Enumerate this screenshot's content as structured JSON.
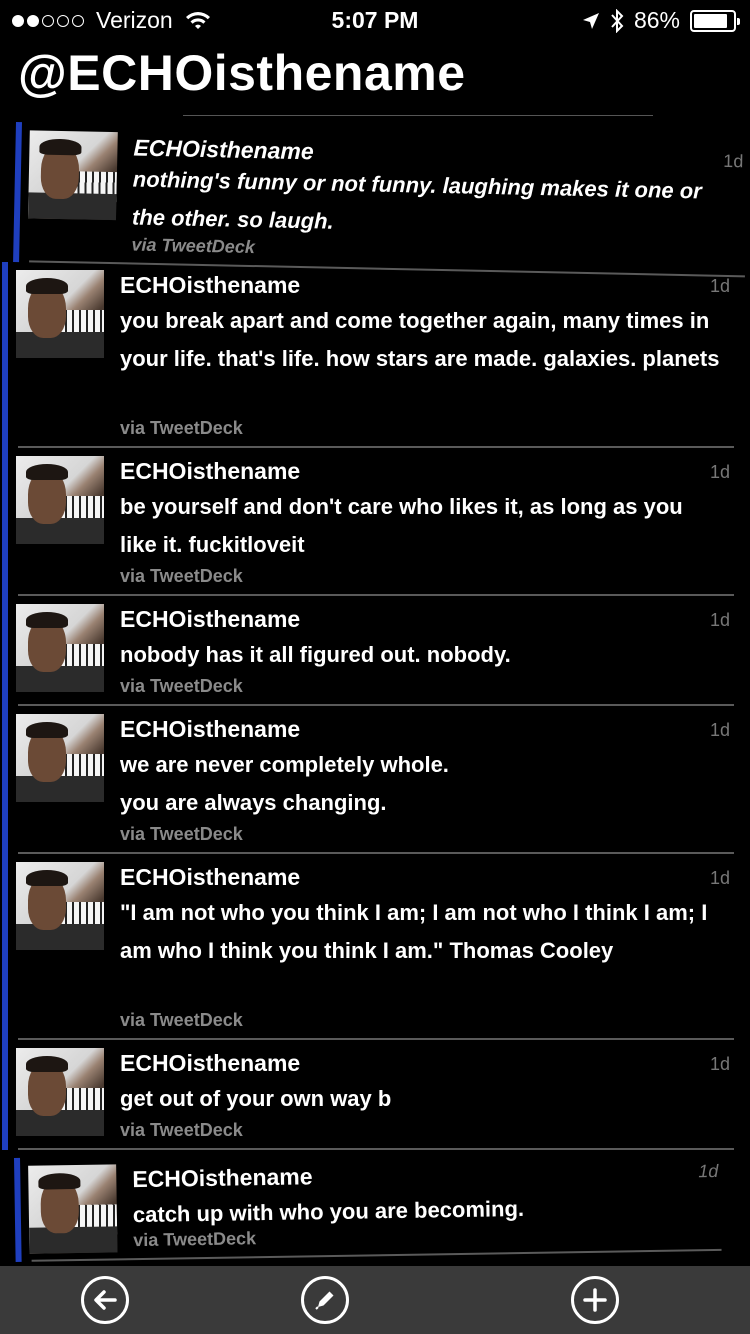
{
  "status_bar": {
    "carrier": "Verizon",
    "time": "5:07 PM",
    "battery": "86%",
    "battery_level": 0.86,
    "signal_dots_filled": 2,
    "signal_dots_total": 5
  },
  "page": {
    "title": "@ECHOisthename"
  },
  "tweets": [
    {
      "name": "ECHOisthename",
      "age": "1d",
      "text": "nothing's funny or not funny. laughing makes it one or the other. so laugh.",
      "via": "via TweetDeck"
    },
    {
      "name": "ECHOisthename",
      "age": "1d",
      "text": "you break apart and come together again, many times in your life. that's life. how stars are made. galaxies. planets",
      "via": "via TweetDeck"
    },
    {
      "name": "ECHOisthename",
      "age": "1d",
      "text": "be yourself and don't care who likes it, as long as you like it. fuckitloveit",
      "via": "via TweetDeck"
    },
    {
      "name": "ECHOisthename",
      "age": "1d",
      "text": "nobody has it all figured out. nobody.",
      "via": "via TweetDeck"
    },
    {
      "name": "ECHOisthename",
      "age": "1d",
      "text": "we are never completely whole.\nyou are always changing.",
      "via": "via TweetDeck"
    },
    {
      "name": "ECHOisthename",
      "age": "1d",
      "text": "\"I am not who you think I am; I am not who I think I am; I am who I think you think I am.\" Thomas Cooley",
      "via": "via TweetDeck"
    },
    {
      "name": "ECHOisthename",
      "age": "1d",
      "text": "get out of your own way b",
      "via": "via TweetDeck"
    },
    {
      "name": "ECHOisthename",
      "age": "1d",
      "text": "catch up with who you are becoming.",
      "via": "via TweetDeck"
    }
  ],
  "toolbar": {
    "back_icon": "back-arrow-icon",
    "compose_icon": "pencil-icon",
    "add_icon": "plus-icon"
  },
  "colors": {
    "background": "#000000",
    "accent_bar": "#1f3fbf",
    "toolbar": "#3a3a3a",
    "meta_text": "#8a8a8a"
  }
}
